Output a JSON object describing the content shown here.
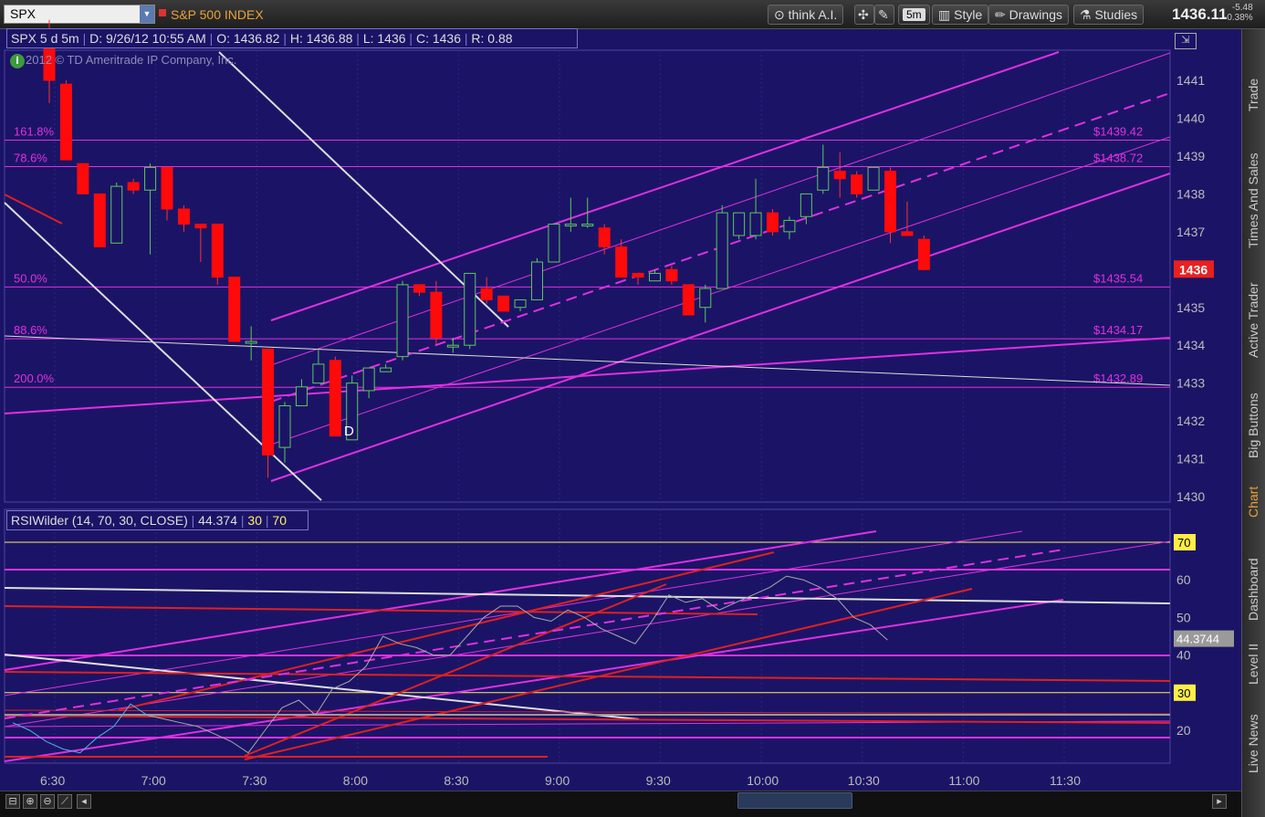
{
  "toolbar": {
    "symbol": "SPX",
    "symbol_description": "S&P 500 INDEX",
    "think_ai_label": "think A.I.",
    "timeframe_label": "5m",
    "style_label": "Style",
    "drawings_label": "Drawings",
    "studies_label": "Studies",
    "last_price": "1436.11",
    "net_change": "-5.48",
    "pct_change": "-0.38%"
  },
  "chart_header": {
    "title": "SPX 5 d 5m",
    "date": "D: 9/26/12 10:55 AM",
    "open": "O: 1436.82",
    "high": "H: 1436.88",
    "low": "L: 1436",
    "close": "C: 1436",
    "range": "R: 0.88"
  },
  "copyright": "2012 © TD Ameritrade IP Company, Inc.",
  "price_axis": {
    "ticks": [
      "1441",
      "1440",
      "1439",
      "1438",
      "1437",
      "1436",
      "1435",
      "1434",
      "1433",
      "1432",
      "1431",
      "1430"
    ],
    "last_badge": "1436"
  },
  "fib_levels": [
    {
      "pct": "161.8%",
      "price": "$1439.42",
      "y": 1439.42
    },
    {
      "pct": "78.6%",
      "price": "$1438.72",
      "y": 1438.72
    },
    {
      "pct": "50.0%",
      "price": "$1435.54",
      "y": 1435.54
    },
    {
      "pct": "88.6%",
      "price": "$1434.17",
      "y": 1434.17
    },
    {
      "pct": "200.0%",
      "price": "$1432.89",
      "y": 1432.89
    }
  ],
  "time_axis": [
    "6:30",
    "7:00",
    "7:30",
    "8:00",
    "8:30",
    "9:00",
    "9:30",
    "10:00",
    "10:30",
    "11:00",
    "11:30"
  ],
  "rsi": {
    "label": "RSIWilder (14, 70, 30, CLOSE)",
    "value": "44.374",
    "overbought": "30",
    "oversold": "70",
    "ticks": [
      "60",
      "50",
      "40",
      "20"
    ],
    "badge_70": "70",
    "badge_30": "30",
    "badge_value": "44.3744"
  },
  "candle_marker": "D",
  "side_tabs": [
    "Trade",
    "Times And Sales",
    "Active Trader",
    "Big Buttons",
    "Chart",
    "Dashboard",
    "Level II",
    "Live News"
  ],
  "colors": {
    "background": "#1b1466",
    "magenta": "#e030e0",
    "up_candle": "#2a6b2a",
    "down_candle": "#ff0a0a",
    "chart_tab_active": "#e8a33a"
  },
  "chart_data": {
    "type": "candlestick",
    "title": "SPX 5 d 5m",
    "xlabel": "",
    "ylabel": "",
    "ylim": [
      1430,
      1441.6
    ],
    "candles": [
      {
        "o": 1442.2,
        "h": 1442.6,
        "l": 1440.4,
        "c": 1441.0
      },
      {
        "o": 1440.9,
        "h": 1441.0,
        "l": 1438.9,
        "c": 1438.9
      },
      {
        "o": 1438.8,
        "h": 1438.8,
        "l": 1438.0,
        "c": 1438.0
      },
      {
        "o": 1438.0,
        "h": 1438.0,
        "l": 1436.6,
        "c": 1436.6
      },
      {
        "o": 1436.7,
        "h": 1438.3,
        "l": 1436.7,
        "c": 1438.2
      },
      {
        "o": 1438.3,
        "h": 1438.4,
        "l": 1438.0,
        "c": 1438.1
      },
      {
        "o": 1438.1,
        "h": 1438.8,
        "l": 1436.4,
        "c": 1438.7
      },
      {
        "o": 1438.7,
        "h": 1438.7,
        "l": 1437.3,
        "c": 1437.6
      },
      {
        "o": 1437.6,
        "h": 1437.7,
        "l": 1437.0,
        "c": 1437.2
      },
      {
        "o": 1437.2,
        "h": 1437.2,
        "l": 1436.2,
        "c": 1437.1
      },
      {
        "o": 1437.2,
        "h": 1437.2,
        "l": 1435.6,
        "c": 1435.8
      },
      {
        "o": 1435.8,
        "h": 1435.8,
        "l": 1434.1,
        "c": 1434.1
      },
      {
        "o": 1434.1,
        "h": 1434.5,
        "l": 1433.6,
        "c": 1434.1
      },
      {
        "o": 1433.9,
        "h": 1433.9,
        "l": 1430.5,
        "c": 1431.1
      },
      {
        "o": 1431.3,
        "h": 1432.5,
        "l": 1430.9,
        "c": 1432.4
      },
      {
        "o": 1432.4,
        "h": 1433.1,
        "l": 1432.4,
        "c": 1432.9
      },
      {
        "o": 1433.0,
        "h": 1433.9,
        "l": 1433.0,
        "c": 1433.5
      },
      {
        "o": 1433.6,
        "h": 1433.7,
        "l": 1431.6,
        "c": 1431.6
      },
      {
        "o": 1431.5,
        "h": 1433.2,
        "l": 1431.5,
        "c": 1433.0
      },
      {
        "o": 1432.8,
        "h": 1433.4,
        "l": 1432.6,
        "c": 1433.4
      },
      {
        "o": 1433.3,
        "h": 1433.5,
        "l": 1433.3,
        "c": 1433.4
      },
      {
        "o": 1433.7,
        "h": 1435.7,
        "l": 1433.6,
        "c": 1435.6
      },
      {
        "o": 1435.6,
        "h": 1435.6,
        "l": 1435.3,
        "c": 1435.4
      },
      {
        "o": 1435.4,
        "h": 1435.7,
        "l": 1434.0,
        "c": 1434.2
      },
      {
        "o": 1434.0,
        "h": 1434.2,
        "l": 1433.8,
        "c": 1434.0
      },
      {
        "o": 1434.0,
        "h": 1435.9,
        "l": 1433.9,
        "c": 1435.9
      },
      {
        "o": 1435.5,
        "h": 1435.8,
        "l": 1435.1,
        "c": 1435.2
      },
      {
        "o": 1435.3,
        "h": 1435.3,
        "l": 1434.9,
        "c": 1434.9
      },
      {
        "o": 1435.0,
        "h": 1435.0,
        "l": 1434.9,
        "c": 1435.2
      },
      {
        "o": 1435.2,
        "h": 1436.3,
        "l": 1435.2,
        "c": 1436.2
      },
      {
        "o": 1436.2,
        "h": 1437.2,
        "l": 1436.2,
        "c": 1437.2
      },
      {
        "o": 1437.2,
        "h": 1437.9,
        "l": 1437.0,
        "c": 1437.2
      },
      {
        "o": 1437.2,
        "h": 1437.9,
        "l": 1437.1,
        "c": 1437.2
      },
      {
        "o": 1437.1,
        "h": 1437.2,
        "l": 1436.4,
        "c": 1436.6
      },
      {
        "o": 1436.6,
        "h": 1436.8,
        "l": 1435.9,
        "c": 1435.8
      },
      {
        "o": 1435.9,
        "h": 1435.8,
        "l": 1435.6,
        "c": 1435.8
      },
      {
        "o": 1435.7,
        "h": 1436.0,
        "l": 1435.7,
        "c": 1435.9
      },
      {
        "o": 1436.0,
        "h": 1436.1,
        "l": 1435.6,
        "c": 1435.7
      },
      {
        "o": 1435.6,
        "h": 1435.6,
        "l": 1434.8,
        "c": 1434.8
      },
      {
        "o": 1435.0,
        "h": 1435.6,
        "l": 1434.6,
        "c": 1435.5
      },
      {
        "o": 1435.5,
        "h": 1437.7,
        "l": 1435.5,
        "c": 1437.5
      },
      {
        "o": 1436.9,
        "h": 1437.5,
        "l": 1436.8,
        "c": 1437.5
      },
      {
        "o": 1436.9,
        "h": 1438.4,
        "l": 1436.8,
        "c": 1437.5
      },
      {
        "o": 1437.5,
        "h": 1437.6,
        "l": 1436.9,
        "c": 1437.0
      },
      {
        "o": 1437.0,
        "h": 1437.4,
        "l": 1436.8,
        "c": 1437.3
      },
      {
        "o": 1437.4,
        "h": 1438.0,
        "l": 1437.2,
        "c": 1438.0
      },
      {
        "o": 1438.1,
        "h": 1439.3,
        "l": 1438.0,
        "c": 1438.7
      },
      {
        "o": 1438.6,
        "h": 1439.1,
        "l": 1437.9,
        "c": 1438.4
      },
      {
        "o": 1438.5,
        "h": 1438.6,
        "l": 1437.9,
        "c": 1438.0
      },
      {
        "o": 1438.1,
        "h": 1438.7,
        "l": 1438.1,
        "c": 1438.7
      },
      {
        "o": 1438.6,
        "h": 1438.7,
        "l": 1436.7,
        "c": 1437.0
      },
      {
        "o": 1437.0,
        "h": 1437.8,
        "l": 1436.9,
        "c": 1436.9
      },
      {
        "o": 1436.8,
        "h": 1436.9,
        "l": 1436.0,
        "c": 1436.0
      }
    ],
    "rsi_values": [
      22,
      20,
      17,
      15,
      14,
      18,
      21,
      27,
      24,
      23,
      22,
      21,
      19,
      17,
      14,
      20,
      26,
      28,
      24,
      31,
      33,
      37,
      45,
      43,
      42,
      40,
      40,
      45,
      50,
      53,
      53,
      50,
      49,
      52,
      50,
      47,
      45,
      43,
      49,
      56,
      54,
      55,
      52,
      54,
      56,
      58,
      61,
      60,
      58,
      55,
      50,
      48,
      44
    ]
  }
}
